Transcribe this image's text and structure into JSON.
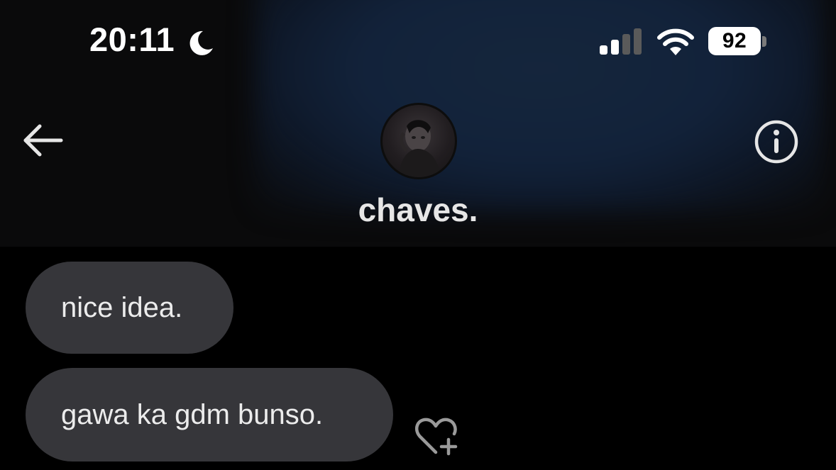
{
  "status_bar": {
    "time": "20:11",
    "focus_mode_icon": "moon-icon",
    "signal_icon": "cellular-signal-icon",
    "wifi_icon": "wifi-icon",
    "battery_level": "92"
  },
  "nav": {
    "back_icon": "arrow-left-icon",
    "info_icon": "info-circle-icon",
    "contact_name": "chaves."
  },
  "messages": [
    {
      "text": "nice idea."
    },
    {
      "text": "gawa ka gdm bunso."
    }
  ],
  "reaction": {
    "icon": "heart-plus-icon"
  },
  "colors": {
    "background": "#000000",
    "header_glow": "#15263c",
    "bubble": "#36363a",
    "bubble_text": "#ececec"
  }
}
